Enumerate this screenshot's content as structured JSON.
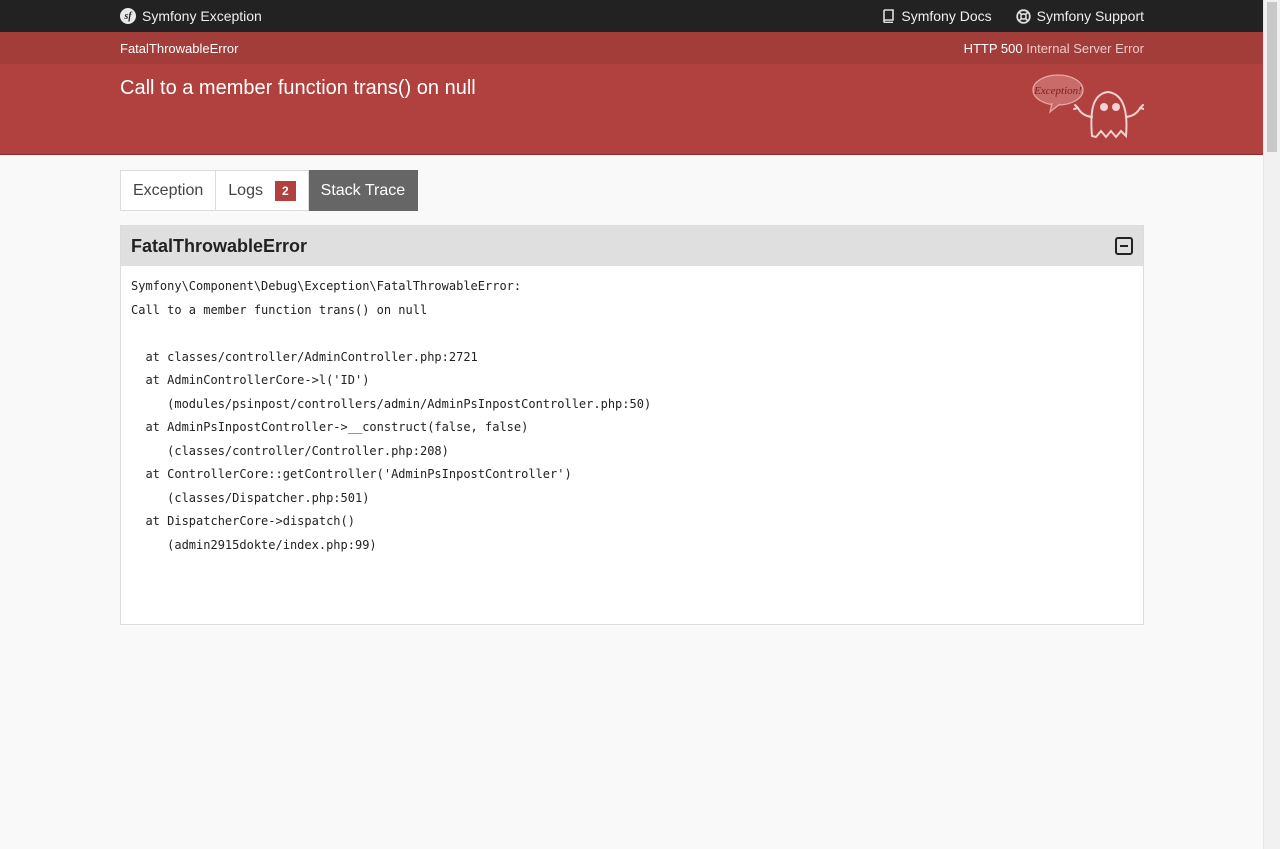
{
  "topbar": {
    "brand_logo_text": "sf",
    "brand": "Symfony Exception",
    "docs_label": "Symfony Docs",
    "support_label": "Symfony Support"
  },
  "subbar": {
    "exception_class": "FatalThrowableError",
    "status_code": "HTTP 500",
    "status_text": "Internal Server Error"
  },
  "summary": {
    "message": "Call to a member function trans() on null",
    "illustration_text": "Exception!"
  },
  "tabs": [
    {
      "label": "Exception"
    },
    {
      "label": "Logs",
      "badge": "2"
    },
    {
      "label": "Stack Trace",
      "active": true
    }
  ],
  "panel": {
    "title": "FatalThrowableError",
    "trace_lines": [
      "Symfony\\Component\\Debug\\Exception\\FatalThrowableError:",
      "Call to a member function trans() on null",
      "",
      "  at classes/controller/AdminController.php:2721",
      "  at AdminControllerCore->l('ID')",
      "     (modules/psinpost/controllers/admin/AdminPsInpostController.php:50)",
      "  at AdminPsInpostController->__construct(false, false)",
      "     (classes/controller/Controller.php:208)",
      "  at ControllerCore::getController('AdminPsInpostController')",
      "     (classes/Dispatcher.php:501)",
      "  at DispatcherCore->dispatch()",
      "     (admin2915dokte/index.php:99)"
    ]
  },
  "colors": {
    "topbar": "#222222",
    "header_red": "#b0413e",
    "subbar_red": "#a33d3a",
    "active_tab": "#666666"
  }
}
